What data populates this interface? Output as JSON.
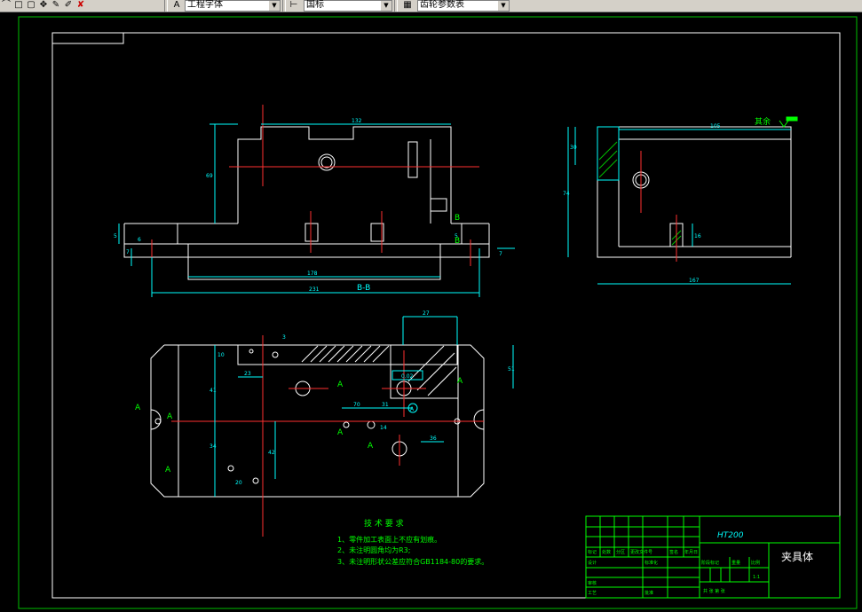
{
  "toolbar": {
    "text_style": "工程字体",
    "dim_style": "国标",
    "table_style": "齿轮参数表"
  },
  "drawing": {
    "section_label": "B-B",
    "surface_note": "其余",
    "dims": {
      "top_width": "132",
      "height_left": "69",
      "base_height": "5",
      "left_step": "6",
      "left_small": "7",
      "right_step": "5",
      "right_small": "7",
      "inner_length": "178",
      "total_length": "231",
      "side_width": "105",
      "side_height_top": "30",
      "side_height": "74",
      "side_base": "167",
      "side_small": "16",
      "plan_27": "27",
      "plan_3": "3",
      "plan_10": "10",
      "plan_23": "23",
      "plan_51": "51",
      "plan_41": "41",
      "plan_34": "34",
      "plan_70": "70",
      "plan_31": "31",
      "plan_14": "14",
      "plan_36": "36",
      "plan_42": "42",
      "plan_20": "20",
      "plan_tol": "0.02",
      "plan_ref": "A"
    },
    "section_marks": {
      "b": "B",
      "a": "A"
    }
  },
  "tech_req": {
    "title": "技 术 要 求",
    "items": [
      "1、零件加工表面上不应有划痕。",
      "2、未注明圆角均为R3;",
      "3、未注明形状公差应符合GB1184-80的要求。"
    ]
  },
  "title_block": {
    "material": "HT200",
    "part_name": "夹具体",
    "header_cells": [
      "标记",
      "处数",
      "分区",
      "更改文件号",
      "签名",
      "年月日"
    ],
    "row_design": "设计",
    "row_standard": "标准化",
    "row_process": "工艺",
    "row_review": "审核",
    "row_approve": "批准",
    "stage_labels": [
      "阶段标记",
      "重量",
      "比例"
    ],
    "scale": "1:1",
    "sheet_text": "共  张  第  张"
  }
}
